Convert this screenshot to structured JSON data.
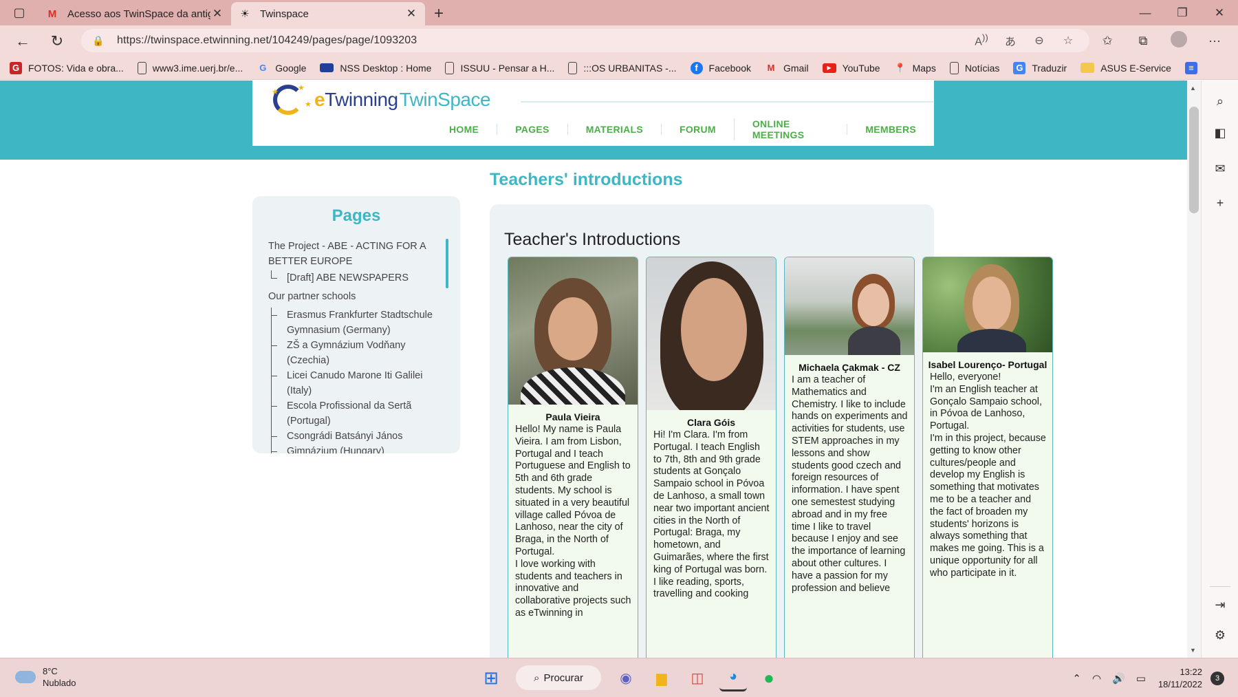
{
  "tabs": [
    {
      "title": "Acesso aos TwinSpace da antiga",
      "favicon": "gmail-icon"
    },
    {
      "title": "Twinspace",
      "favicon": "twinspace-icon"
    }
  ],
  "address": {
    "url": "https://twinspace.etwinning.net/104249/pages/page/1093203"
  },
  "bookmarks": [
    {
      "label": "FOTOS: Vida e obra...",
      "glyph": "G"
    },
    {
      "label": "www3.ime.uerj.br/e...",
      "glyph": ""
    },
    {
      "label": "Google",
      "glyph": "G"
    },
    {
      "label": "NSS Desktop : Home",
      "glyph": ""
    },
    {
      "label": "ISSUU - Pensar a H...",
      "glyph": ""
    },
    {
      "label": ":::OS URBANITAS -...",
      "glyph": ""
    },
    {
      "label": "Facebook",
      "glyph": "f"
    },
    {
      "label": "Gmail",
      "glyph": "M"
    },
    {
      "label": "YouTube",
      "glyph": "▶"
    },
    {
      "label": "Maps",
      "glyph": ""
    },
    {
      "label": "Notícias",
      "glyph": ""
    },
    {
      "label": "Traduzir",
      "glyph": "G"
    },
    {
      "label": "ASUS E-Service",
      "glyph": ""
    }
  ],
  "site": {
    "brand_e": "e",
    "brand_twinning": "Twinning",
    "brand_twinspace": "TwinSpace",
    "nav": [
      "HOME",
      "PAGES",
      "MATERIALS",
      "FORUM",
      "ONLINE MEETINGS",
      "MEMBERS"
    ]
  },
  "sidebar": {
    "title": "Pages",
    "items": [
      {
        "label": "The Project - ABE - ACTING FOR A BETTER EUROPE",
        "child": false
      },
      {
        "label": "[Draft] ABE NEWSPAPERS",
        "child": true
      },
      {
        "label": "Our partner schools",
        "child": false
      },
      {
        "label": "Erasmus Frankfurter Stadtschule Gymnasium (Germany)",
        "child": true
      },
      {
        "label": "ZŠ a Gymnázium Vodňany (Czechia)",
        "child": true
      },
      {
        "label": "Licei Canudo Marone Iti Galilei (Italy)",
        "child": true
      },
      {
        "label": "Escola Profissional da Sertã (Portugal)",
        "child": true
      },
      {
        "label": "Csongrádi Batsányi János",
        "child": true
      },
      {
        "label": "Gimnázium (Hungary)",
        "child": true
      }
    ]
  },
  "content": {
    "title": "Teachers' introductions",
    "heading": "Teacher's Introductions",
    "teachers": [
      {
        "name": "Paula Vieira",
        "bio": "Hello! My name is Paula Vieira. I am from Lisbon, Portugal and I teach Portuguese and English to 5th and 6th grade students. My school is situated in a very beautiful village called Póvoa de Lanhoso, near the city of Braga, in the North of Portugal.\nI love working with students and teachers in innovative and collaborative projects such as eTwinning in"
      },
      {
        "name": "Clara Góis",
        "bio": "Hi! I'm Clara. I'm from Portugal. I teach English to 7th, 8th and 9th grade students at Gonçalo Sampaio school in Póvoa de Lanhoso, a small town near two important ancient cities in the North of Portugal: Braga, my hometown, and Guimarães, where the first king of Portugal was born.\nI like reading, sports, travelling and cooking"
      },
      {
        "name": "Michaela Çakmak - CZ",
        "bio": "I am a teacher of Mathematics and Chemistry. I like to include hands on experiments and activities for students, use STEM approaches in my lessons and show students good czech and foreign resources of information. I have spent one semestest studying abroad and in my free time I like to travel because I enjoy and see the importance of learning about other cultures. I have a passion for my profession and believe"
      },
      {
        "name": "Isabel Lourenço- Portugal",
        "bio": "Hello, everyone!\nI'm an English teacher at Gonçalo Sampaio school, in Póvoa de Lanhoso, Portugal.\nI'm in this project, because getting to know other cultures/people and develop my English is something that motivates me to be a teacher and the fact of broaden my students' horizons is always something that makes me going. This is a unique opportunity for all who participate in it."
      }
    ]
  },
  "taskbar": {
    "weather_temp": "8°C",
    "weather_desc": "Nublado",
    "search_label": "Procurar",
    "time": "13:22",
    "date": "18/11/2022",
    "notifications": "3"
  }
}
